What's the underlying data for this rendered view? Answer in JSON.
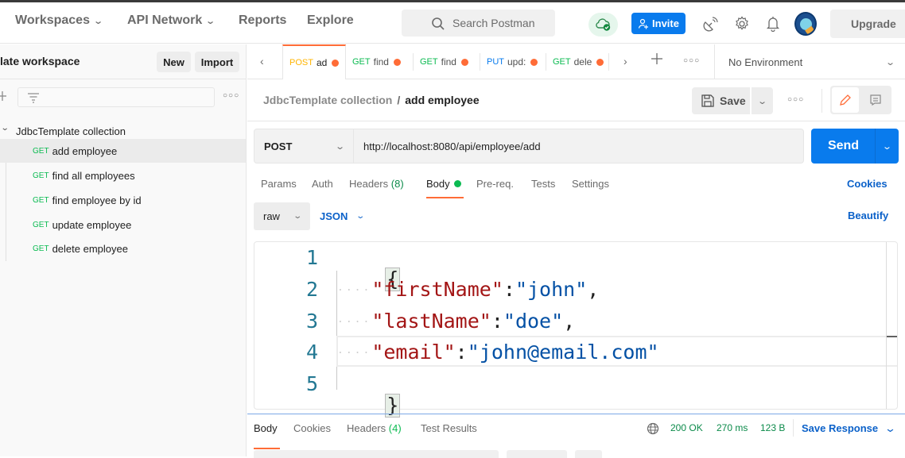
{
  "header": {
    "nav": [
      {
        "label": "Workspaces",
        "has_dropdown": true
      },
      {
        "label": "API Network",
        "has_dropdown": true
      },
      {
        "label": "Reports",
        "has_dropdown": false
      },
      {
        "label": "Explore",
        "has_dropdown": false
      }
    ],
    "search_placeholder": "Search Postman",
    "invite_label": "Invite",
    "upgrade_label": "Upgrade",
    "icons": [
      "cloud-sync-icon",
      "satellite-icon",
      "settings-gear-icon",
      "bell-icon",
      "avatar"
    ]
  },
  "sidebar": {
    "workspace_title": "late workspace",
    "new_label": "New",
    "import_label": "Import",
    "collection": {
      "name": "JdbcTemplate collection",
      "expanded": true,
      "items": [
        {
          "method": "GET",
          "label": "add employee",
          "active": true
        },
        {
          "method": "GET",
          "label": "find all employees",
          "active": false
        },
        {
          "method": "GET",
          "label": "find employee by id",
          "active": false
        },
        {
          "method": "GET",
          "label": "update employee",
          "active": false
        },
        {
          "method": "GET",
          "label": "delete employee",
          "active": false
        }
      ]
    }
  },
  "tabs": [
    {
      "method": "POST",
      "label": "ad",
      "method_color": "#ffb400",
      "unsaved": true,
      "active": true
    },
    {
      "method": "GET",
      "label": "find",
      "method_color": "#0cbb52",
      "unsaved": true,
      "active": false
    },
    {
      "method": "GET",
      "label": "find",
      "method_color": "#0cbb52",
      "unsaved": true,
      "active": false
    },
    {
      "method": "PUT",
      "label": "upd:",
      "method_color": "#097bed",
      "unsaved": true,
      "active": false
    },
    {
      "method": "GET",
      "label": "dele",
      "method_color": "#0cbb52",
      "unsaved": true,
      "active": false
    }
  ],
  "environment": {
    "selected": "No Environment"
  },
  "breadcrumb": {
    "parent": "JdbcTemplate collection",
    "separator": "/",
    "current": "add employee"
  },
  "save_label": "Save",
  "request": {
    "method": "POST",
    "url": "http://localhost:8080/api/employee/add",
    "send_label": "Send"
  },
  "request_tabs": {
    "params": "Params",
    "auth": "Auth",
    "headers": "Headers",
    "headers_count": "(8)",
    "body": "Body",
    "prereq": "Pre-req.",
    "tests": "Tests",
    "settings": "Settings",
    "active": "Body",
    "cookies_link": "Cookies"
  },
  "body_options": {
    "mode": "raw",
    "language": "JSON",
    "beautify_label": "Beautify"
  },
  "editor": {
    "line_numbers": [
      "1",
      "2",
      "3",
      "4",
      "5"
    ],
    "open_brace": "{",
    "close_brace": "}",
    "pairs": [
      {
        "key": "\"firstName\"",
        "value": "\"john\"",
        "trail": ","
      },
      {
        "key": "\"lastName\"",
        "value": "\"doe\"",
        "trail": ","
      },
      {
        "key": "\"email\"",
        "value": "\"john@email.com\"",
        "trail": ""
      }
    ],
    "colon": ":",
    "indent_dots": "····"
  },
  "response": {
    "tabs": {
      "body": "Body",
      "cookies": "Cookies",
      "headers": "Headers",
      "headers_count": "(4)",
      "test_results": "Test Results",
      "active": "Body"
    },
    "status": "200 OK",
    "time": "270 ms",
    "size": "123 B",
    "save_response_label": "Save Response"
  },
  "colors": {
    "accent_orange": "#ff6c37",
    "primary_blue": "#097bed",
    "link_blue": "#0b61c9",
    "get_green": "#0cbb52",
    "post_yellow": "#ffb400",
    "status_green": "#0b8a4a"
  }
}
